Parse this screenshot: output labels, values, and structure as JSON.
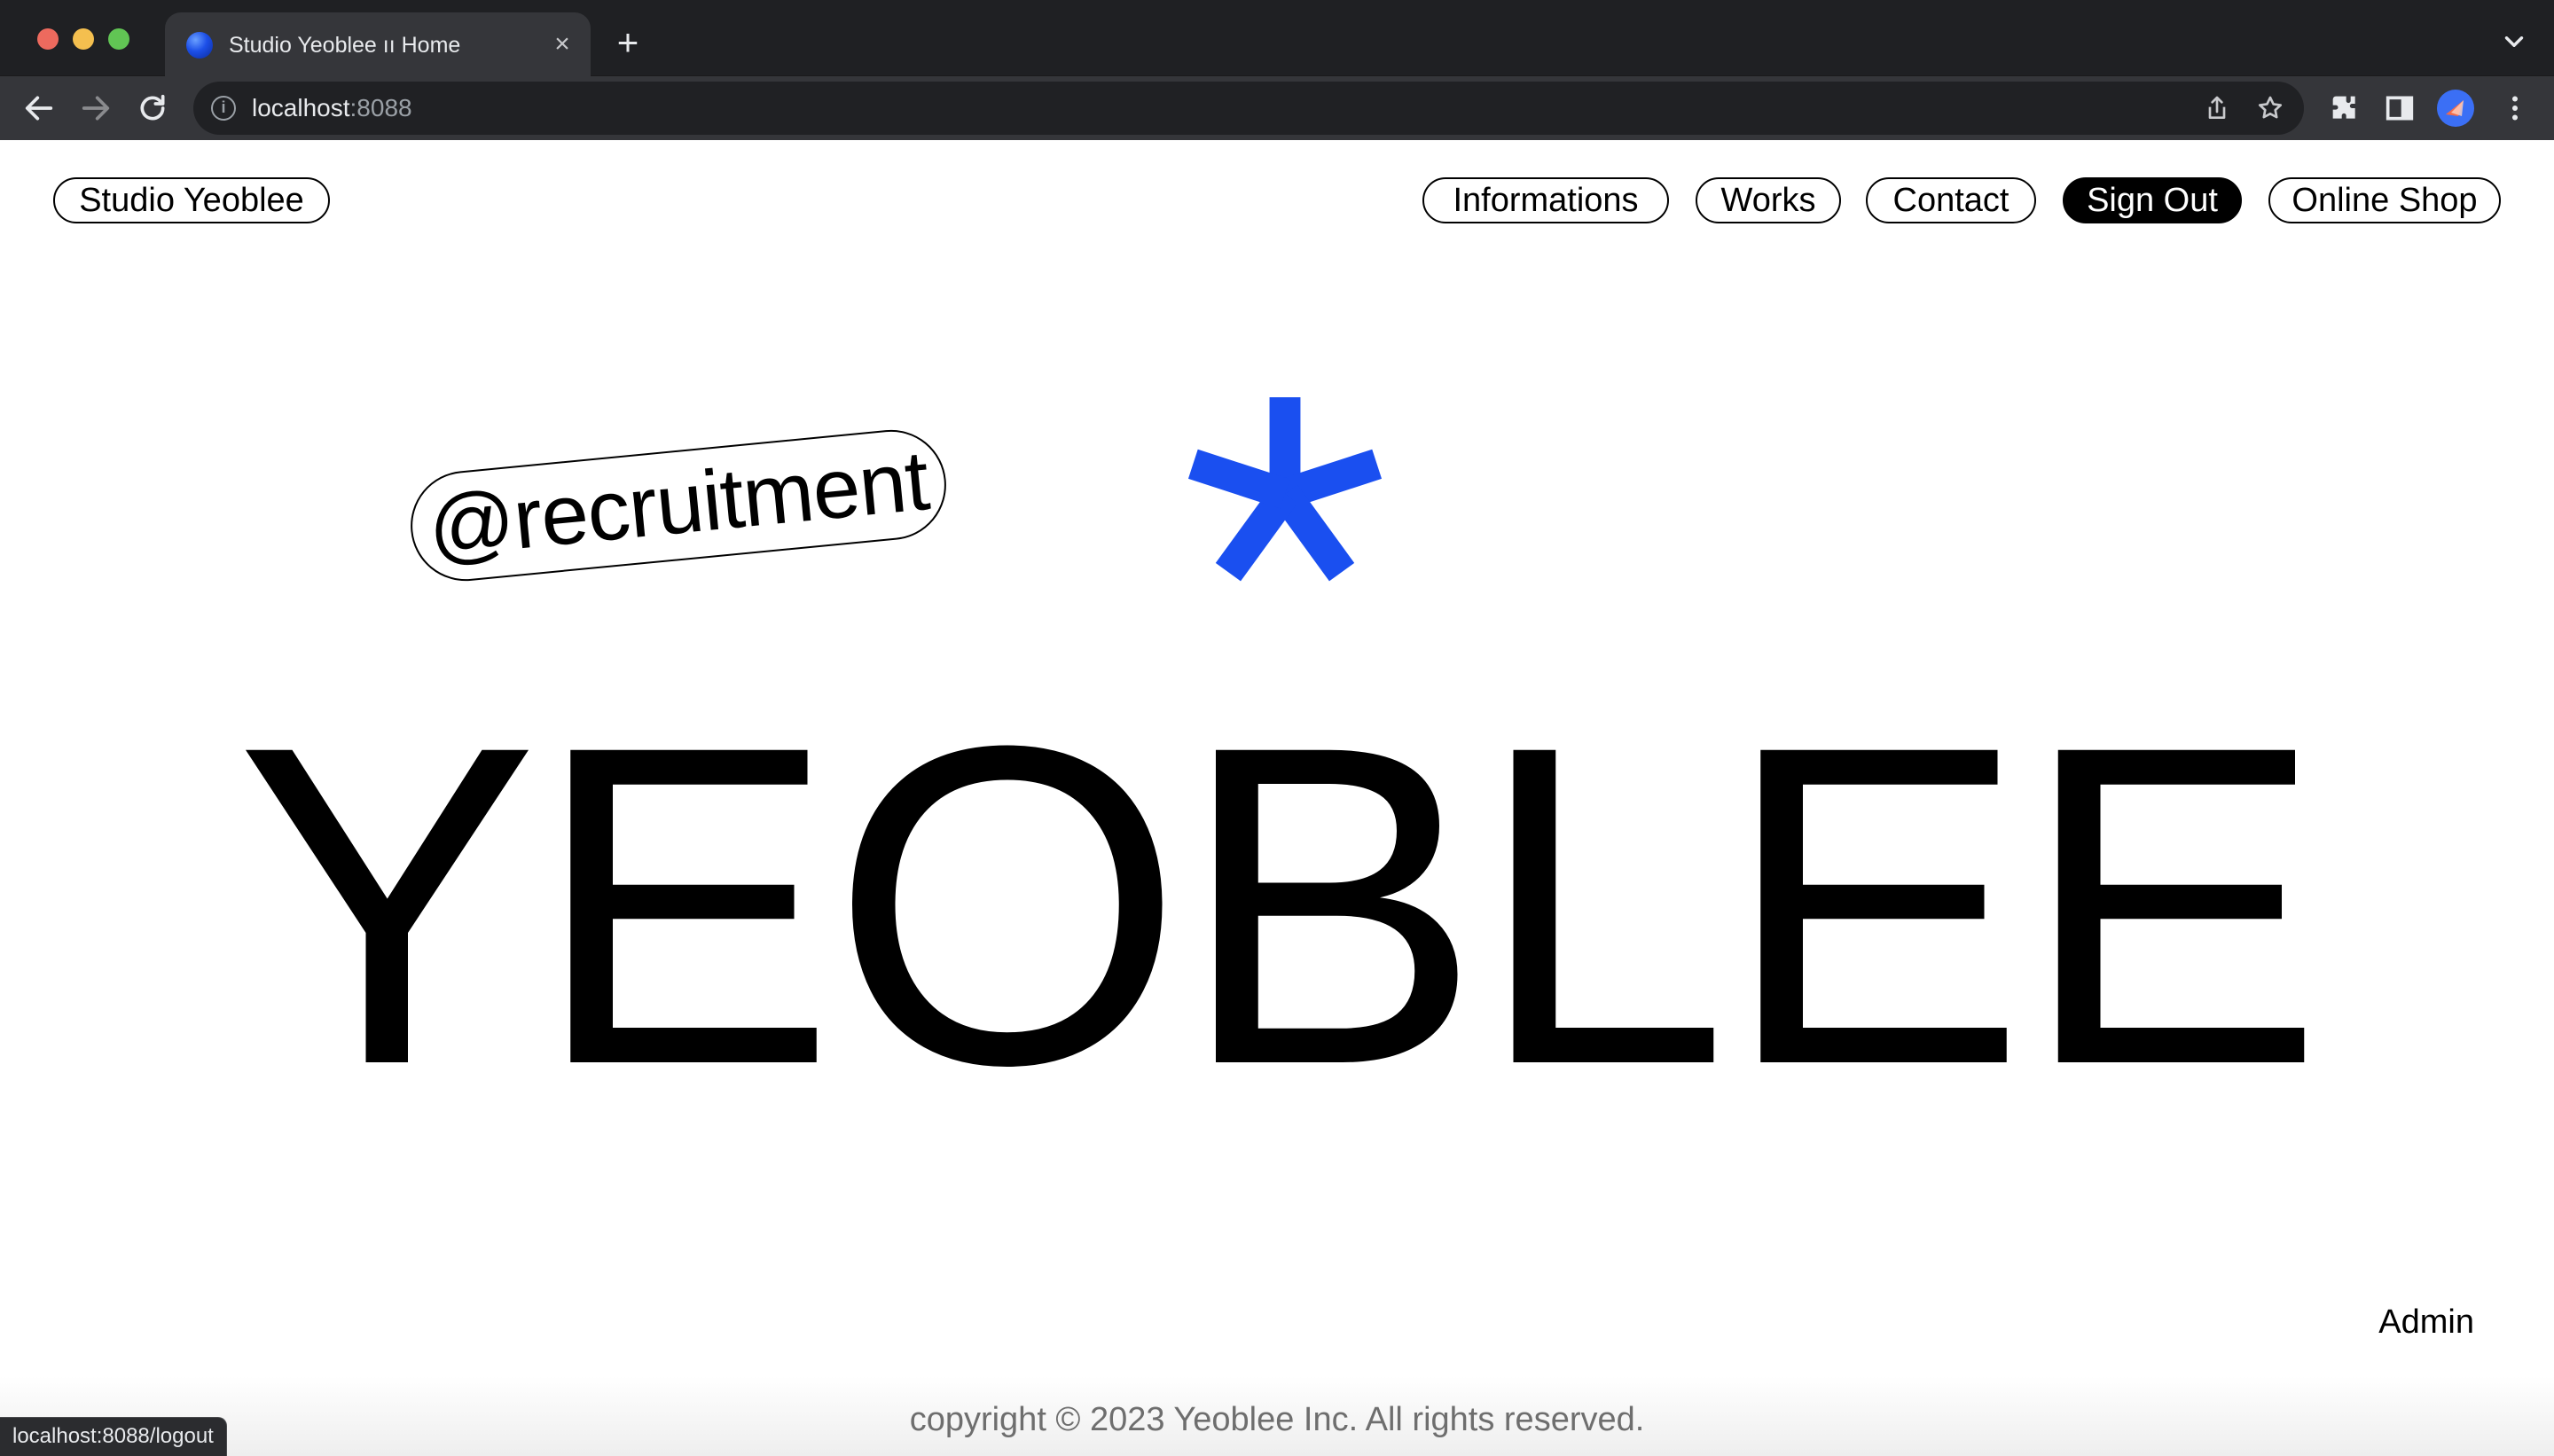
{
  "browser": {
    "tab": {
      "title": "Studio Yeoblee ıı Home",
      "close_glyph": "×"
    },
    "new_tab_glyph": "+",
    "omnibox": {
      "host": "localhost",
      "port": ":8088",
      "info_glyph": "i"
    },
    "status_url": "localhost:8088/logout"
  },
  "nav": {
    "brand": "Studio Yeoblee",
    "links": [
      "Informations",
      "Works",
      "Contact",
      "Sign Out",
      "Online Shop"
    ]
  },
  "hero": {
    "badge": "@recruitment",
    "wordmark": "YEOBLEE",
    "asterisk_color": "#1a4ff0"
  },
  "admin_link": "Admin",
  "footer": {
    "copyright": "copyright © 2023 Yeoblee Inc. All rights reserved."
  }
}
